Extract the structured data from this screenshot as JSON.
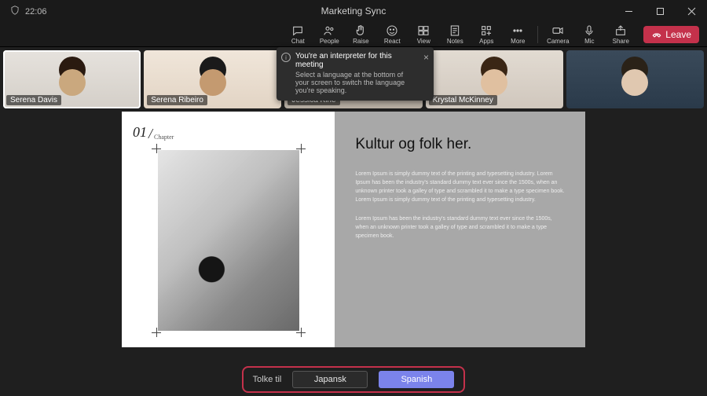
{
  "window": {
    "title": "Marketing Sync"
  },
  "clock": {
    "time": "22:06"
  },
  "toolbar": {
    "chat": "Chat",
    "people": "People",
    "raise": "Raise",
    "react": "React",
    "view": "View",
    "notes": "Notes",
    "apps": "Apps",
    "more": "More",
    "camera": "Camera",
    "mic": "Mic",
    "share": "Share",
    "leave": "Leave"
  },
  "participants": [
    {
      "name": "Serena Davis"
    },
    {
      "name": "Serena Ribeiro"
    },
    {
      "name": "Jessica Kine"
    },
    {
      "name": "Krystal McKinney"
    },
    {
      "name": ""
    }
  ],
  "notification": {
    "title": "You're an interpreter for this meeting",
    "body": "Select a language at the bottom of your screen to switch the language you're speaking."
  },
  "slide": {
    "chapter_num": "01",
    "chapter_label": "Chapter",
    "heading": "Kultur og folk her.",
    "para1": "Lorem Ipsum is simply dummy text of the printing and typesetting industry. Lorem Ipsum has been the industry's standard dummy text ever since the 1500s, when an unknown printer took a galley of type and scrambled it to make a type specimen book. Lorem Ipsum is simply dummy text of the printing and typesetting industry.",
    "para2": "Lorem Ipsum has been the industry's standard dummy text ever since the 1500s, when an unknown printer took a galley of type and scrambled it to make a type specimen book."
  },
  "interpreter": {
    "label": "Tolke til",
    "options": [
      "Japansk",
      "Spanish"
    ],
    "selected": "Spanish"
  }
}
